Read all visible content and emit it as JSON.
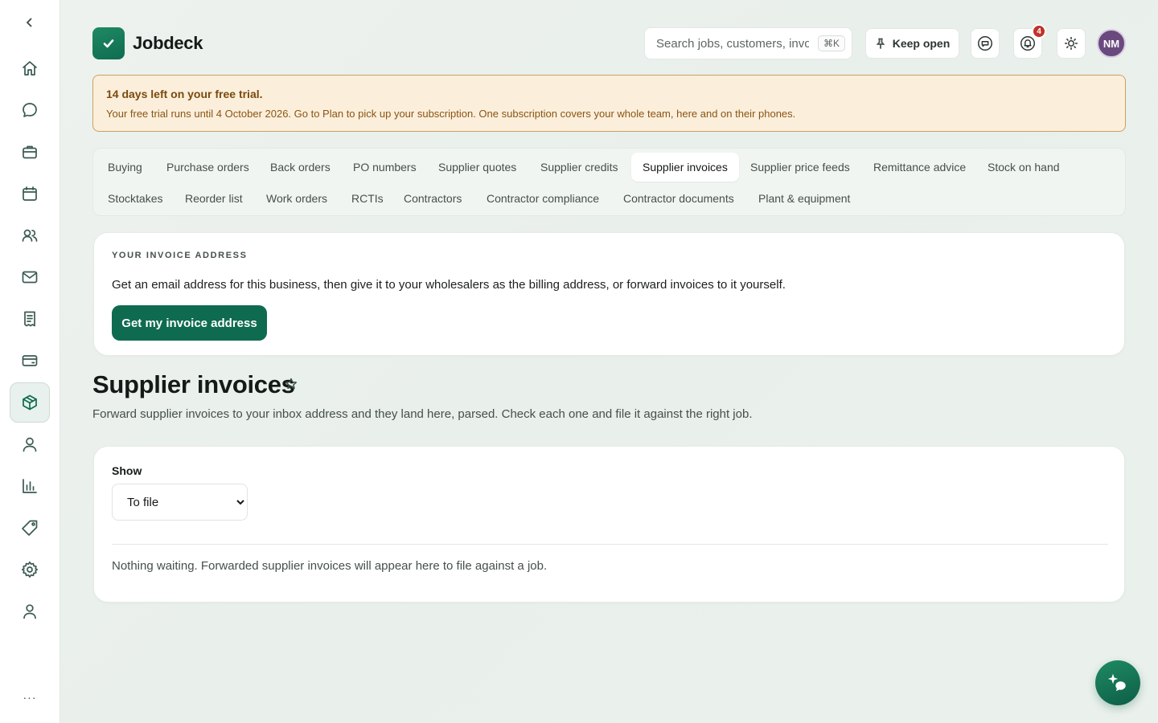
{
  "brand": {
    "name": "Jobdeck"
  },
  "header": {
    "search_placeholder": "Search jobs, customers, invoices",
    "search_shortcut": "⌘K",
    "keep_open_label": "Keep open",
    "notifications_count": "4",
    "avatar_initials": "NM"
  },
  "sidebar": {
    "items": [
      {
        "icon": "home-icon"
      },
      {
        "icon": "chat-icon"
      },
      {
        "icon": "briefcase-icon"
      },
      {
        "icon": "calendar-icon"
      },
      {
        "icon": "users-icon"
      },
      {
        "icon": "mail-icon"
      },
      {
        "icon": "receipt-icon"
      },
      {
        "icon": "wallet-icon"
      },
      {
        "icon": "box-icon",
        "active": true
      },
      {
        "icon": "person-icon"
      },
      {
        "icon": "bar-chart-icon"
      },
      {
        "icon": "tag-icon"
      },
      {
        "icon": "gear-icon"
      },
      {
        "icon": "profile-icon"
      }
    ],
    "more_label": "···"
  },
  "trial": {
    "title": "14 days left on your free trial.",
    "text": "Your free trial runs until 4 October 2026. Go to Plan to pick up your subscription. One subscription covers your whole team, here and on their phones."
  },
  "tabs": [
    "Buying",
    "Purchase orders",
    "Back orders",
    "PO numbers",
    "Supplier quotes",
    "Supplier credits",
    "Supplier invoices",
    "Supplier price feeds",
    "Remittance advice",
    "Stock on hand",
    "Stocktakes",
    "Reorder list",
    "Work orders",
    "RCTIs",
    "Contractors",
    "Contractor compliance",
    "Contractor documents",
    "Plant & equipment"
  ],
  "active_tab": "Supplier invoices",
  "invoice_address": {
    "eyebrow": "YOUR INVOICE ADDRESS",
    "text": "Get an email address for this business, then give it to your wholesalers as the billing address, or forward invoices to it yourself.",
    "button_label": "Get my invoice address"
  },
  "page": {
    "title": "Supplier invoices",
    "subtitle": "Forward supplier invoices to your inbox address and they land here, parsed. Check each one and file it against the right job."
  },
  "filter": {
    "label": "Show",
    "selected": "To file",
    "empty_text": "Nothing waiting. Forwarded supplier invoices will appear here to file against a job."
  },
  "colors": {
    "accent": "#0f6b50",
    "trial_bg": "#fbefdc",
    "trial_border": "#c9a25e",
    "badge": "#c0322b",
    "avatar": "#6a4a7e"
  }
}
